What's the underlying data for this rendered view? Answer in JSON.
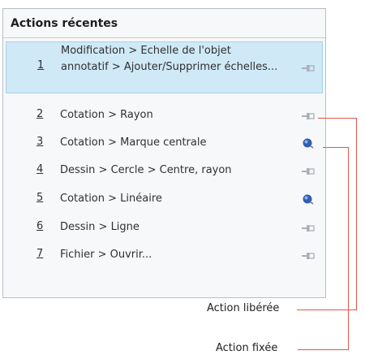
{
  "panel": {
    "title": "Actions récentes",
    "items": [
      {
        "number": "1",
        "label": "Modification > Echelle de l'objet annotatif > Ajouter/Supprimer échelles...",
        "pin_state": "unpinned",
        "icon": "pushpin-icon"
      },
      {
        "number": "2",
        "label": "Cotation > Rayon",
        "pin_state": "unpinned",
        "icon": "pushpin-icon"
      },
      {
        "number": "3",
        "label": "Cotation > Marque centrale",
        "pin_state": "pinned",
        "icon": "pin-ball-icon"
      },
      {
        "number": "4",
        "label": "Dessin > Cercle > Centre, rayon",
        "pin_state": "unpinned",
        "icon": "pushpin-icon"
      },
      {
        "number": "5",
        "label": "Cotation > Linéaire",
        "pin_state": "pinned",
        "icon": "pin-ball-icon"
      },
      {
        "number": "6",
        "label": "Dessin > Ligne",
        "pin_state": "unpinned",
        "icon": "pushpin-icon"
      },
      {
        "number": "7",
        "label": "Fichier > Ouvrir...",
        "pin_state": "unpinned",
        "icon": "pushpin-icon"
      }
    ]
  },
  "callouts": {
    "released": "Action libérée",
    "pinned": "Action fixée"
  },
  "colors": {
    "selected_bg": "#cfe9f7",
    "pinned_icon": "#2f5fb3",
    "unpinned_icon": "#a9b1b8",
    "callout_line": "#e0564c"
  }
}
